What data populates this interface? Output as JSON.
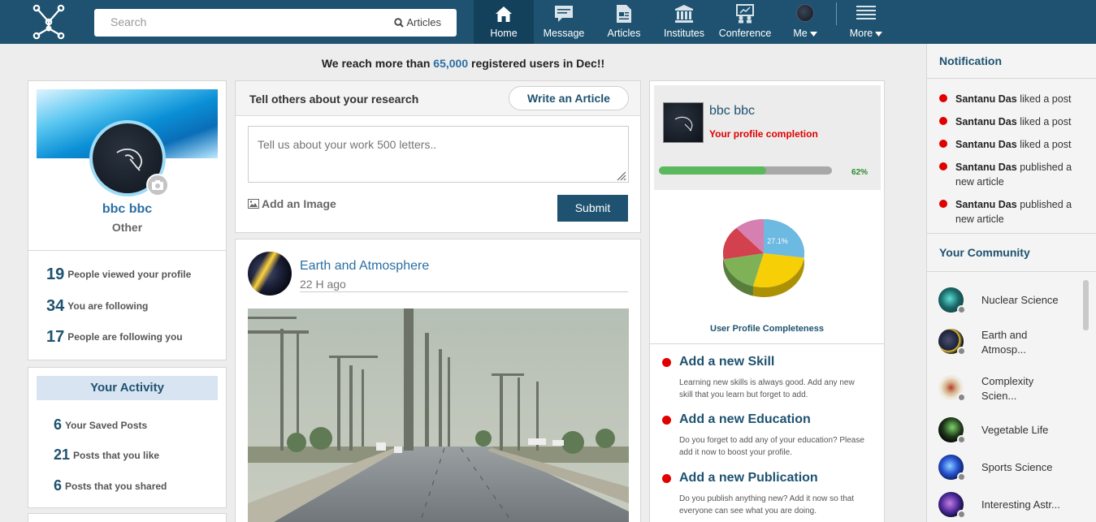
{
  "search": {
    "placeholder": "Search",
    "scope": "Articles"
  },
  "nav": [
    {
      "label": "Home",
      "icon": "home-icon"
    },
    {
      "label": "Message",
      "icon": "message-icon"
    },
    {
      "label": "Articles",
      "icon": "articles-icon"
    },
    {
      "label": "Institutes",
      "icon": "institutes-icon"
    },
    {
      "label": "Conference",
      "icon": "conference-icon"
    },
    {
      "label": "Me",
      "icon": "avatar"
    },
    {
      "label": "More",
      "icon": "menu-icon"
    }
  ],
  "banner": {
    "pre": "We reach more than ",
    "num": "65,000",
    "post": " registered users in Dec!!"
  },
  "profile": {
    "name": "bbc bbc",
    "role": "Other"
  },
  "stats": [
    {
      "num": "19",
      "label": "People viewed your profile"
    },
    {
      "num": "34",
      "label": "You are following"
    },
    {
      "num": "17",
      "label": "People are following you"
    }
  ],
  "activity": {
    "title": "Your Activity",
    "items": [
      {
        "num": "6",
        "label": "Your Saved Posts"
      },
      {
        "num": "21",
        "label": "Posts that you like"
      },
      {
        "num": "6",
        "label": "Posts that you shared"
      }
    ]
  },
  "composer": {
    "title": "Tell others about your research",
    "write_btn": "Write an Article",
    "placeholder": "Tell us about your work 500 letters..",
    "add_image": "Add an Image",
    "submit": "Submit"
  },
  "feed": {
    "title": "Earth and Atmosphere",
    "time": "22 H ago"
  },
  "completion": {
    "name": "bbc bbc",
    "subtitle": "Your profile completion",
    "percent": 62,
    "percent_label": "62%",
    "pie_label": "27.1%",
    "pie_caption": "User Profile Completeness",
    "pie_slices": [
      {
        "value": 27.1,
        "color": "#6cb9e1"
      },
      {
        "value": 27.1,
        "color": "#f7cf06"
      },
      {
        "value": 18.0,
        "color": "#7fb257"
      },
      {
        "value": 16.0,
        "color": "#d2414d"
      },
      {
        "value": 11.8,
        "color": "#d580b0"
      }
    ]
  },
  "tasks": [
    {
      "title": "Add a new Skill",
      "desc": "Learning new skills is always good. Add any new skill that you learn but forget to add."
    },
    {
      "title": "Add a new Education",
      "desc": "Do you forget to add any of your education? Please add it now to boost your profile."
    },
    {
      "title": "Add a new Publication",
      "desc": "Do you publish anything new? Add it now so that everyone can see what you are doing."
    }
  ],
  "notifications": {
    "title": "Notification",
    "items": [
      {
        "who": "Santanu Das",
        "what": " liked a post"
      },
      {
        "who": "Santanu Das",
        "what": " liked a post"
      },
      {
        "who": "Santanu Das",
        "what": " liked a post"
      },
      {
        "who": "Santanu Das",
        "what": " published a new article"
      },
      {
        "who": "Santanu Das",
        "what": " published a new article"
      }
    ]
  },
  "community": {
    "title": "Your Community",
    "items": [
      {
        "name": "Nuclear Science"
      },
      {
        "name": "Earth and Atmosp..."
      },
      {
        "name": "Complexity Scien..."
      },
      {
        "name": "Vegetable Life"
      },
      {
        "name": "Sports Science"
      },
      {
        "name": "Interesting Astr..."
      }
    ]
  },
  "colors": {
    "brand": "#1e5270",
    "accent": "#2b6ea3",
    "alert": "#e00000",
    "progress": "#5cb85c"
  }
}
